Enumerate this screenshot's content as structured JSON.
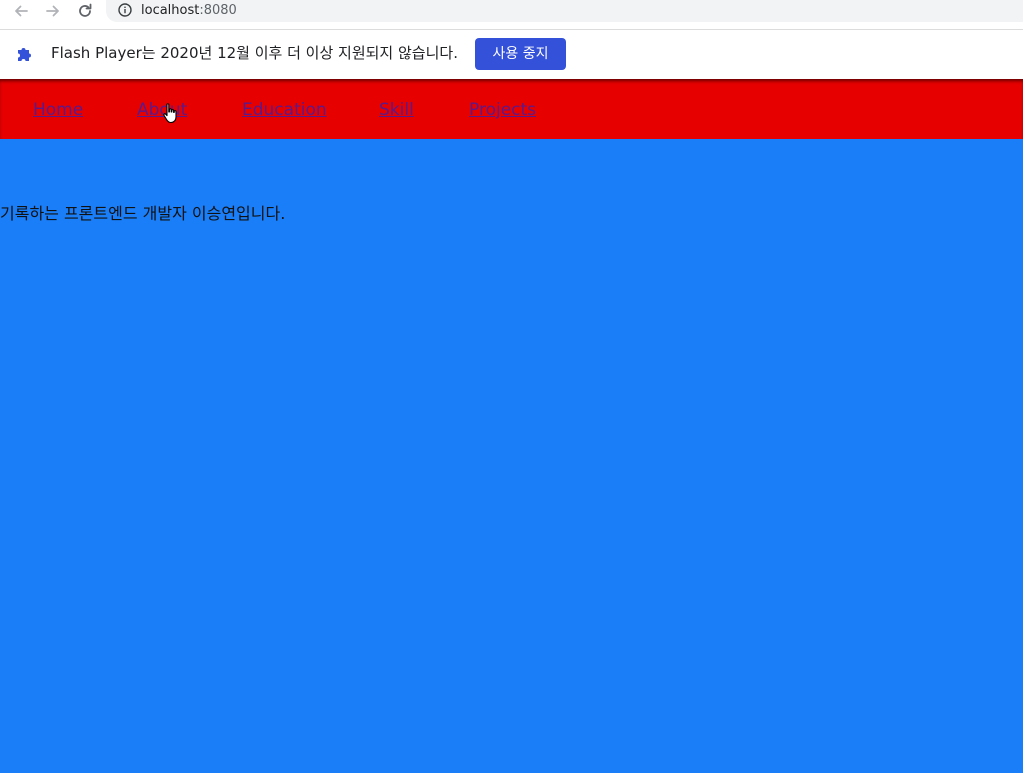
{
  "browser": {
    "url_host": "localhost",
    "url_port": ":8080"
  },
  "infobar": {
    "message": "Flash Player는 2020년 12월 이후 더 이상 지원되지 않습니다.",
    "button_label": "사용 중지"
  },
  "nav": {
    "items": [
      {
        "label": "Home"
      },
      {
        "label": "About"
      },
      {
        "label": "Education"
      },
      {
        "label": "Skill"
      },
      {
        "label": "Projects"
      }
    ]
  },
  "main": {
    "intro_text": "기록하는 프론트엔드 개발자 이승연입니다."
  },
  "colors": {
    "nav_background": "#e60000",
    "body_background": "#1a7ef8",
    "infobar_button": "#3451d9",
    "link": "#5a1a8c"
  },
  "icons": {
    "back": "arrow-left-icon",
    "forward": "arrow-right-icon",
    "reload": "reload-icon",
    "site_info": "info-icon",
    "extension": "puzzle-icon",
    "cursor": "hand-pointer-icon"
  }
}
